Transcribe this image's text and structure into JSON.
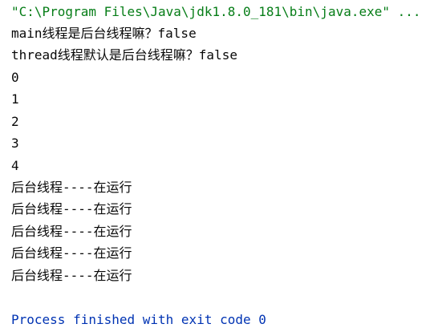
{
  "console": {
    "command": "\"C:\\Program Files\\Java\\jdk1.8.0_181\\bin\\java.exe\" ...",
    "output_lines": [
      "main线程是后台线程嘛？false",
      "thread线程默认是后台线程嘛？false",
      "0",
      "1",
      "2",
      "3",
      "4",
      "后台线程----在运行",
      "后台线程----在运行",
      "后台线程----在运行",
      "后台线程----在运行",
      "后台线程----在运行"
    ],
    "exit_message": "Process finished with exit code 0"
  },
  "colors": {
    "command": "#067D17",
    "output": "#080808",
    "exit_message": "#0033B3",
    "background": "#FFFFFF"
  }
}
